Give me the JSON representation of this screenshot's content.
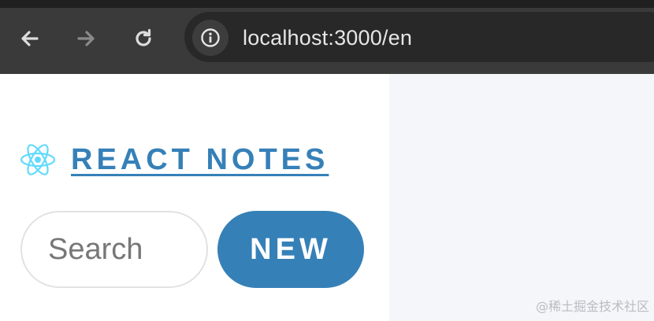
{
  "browser": {
    "url": "localhost:3000/en",
    "icons": {
      "back": "arrow-left-icon",
      "forward": "arrow-right-icon",
      "reload": "reload-icon",
      "site_info": "info-icon"
    }
  },
  "sidebar": {
    "brand": {
      "logo_icon": "react-logo-icon",
      "title": "REACT NOTES"
    },
    "search": {
      "placeholder": "Search",
      "value": ""
    },
    "new_button_label": "NEW"
  },
  "watermark": "@稀土掘金技术社区",
  "colors": {
    "accent": "#3680b8",
    "react_logo": "#61dafb",
    "main_background": "#f5f6fa"
  }
}
